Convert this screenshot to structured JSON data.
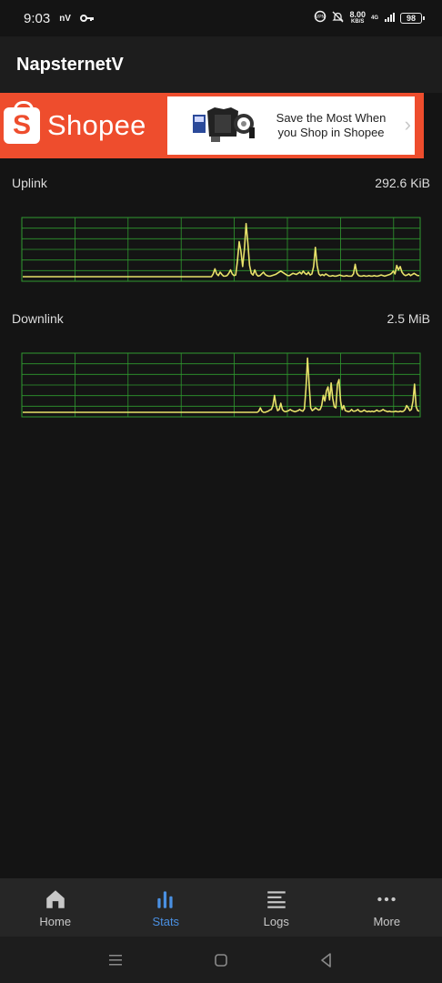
{
  "status_bar": {
    "time": "9:03",
    "carrier_text": "nV",
    "speed_value": "8.00",
    "speed_unit": "KB/S",
    "network_gen": "4G",
    "battery": "98",
    "icons": [
      "key-icon",
      "vpn-icon",
      "bell-muted-icon",
      "signal-icon",
      "battery-icon"
    ]
  },
  "app": {
    "title": "NapsternetV"
  },
  "ad": {
    "brand": "Shopee",
    "slogan": "Save the Most When you Shop in Shopee",
    "brand_color": "#ee4d2d"
  },
  "uplink": {
    "label": "Uplink",
    "value": "292.6 KiB",
    "samples": [
      0,
      0,
      0,
      0,
      0,
      0,
      0,
      0,
      0,
      0,
      0,
      0,
      0,
      0,
      0,
      0,
      0,
      0,
      0,
      0,
      0,
      0,
      0,
      0,
      0,
      0,
      0,
      0,
      0,
      0,
      0,
      0,
      0,
      0,
      0,
      0,
      0,
      0,
      0,
      0,
      0,
      0,
      0,
      0,
      0,
      0,
      0,
      0,
      0,
      0,
      0,
      0,
      0,
      0,
      0,
      0,
      0,
      0,
      0,
      0,
      0,
      0,
      0,
      0,
      0,
      0,
      0,
      0,
      0,
      0,
      0,
      0,
      0,
      0,
      0,
      0,
      0,
      0,
      0,
      0,
      0,
      0,
      0,
      0,
      0,
      0,
      0,
      0,
      0,
      0,
      0,
      0,
      0,
      0,
      0,
      0,
      0,
      0,
      0,
      0,
      0,
      0,
      0,
      0,
      0,
      0,
      0,
      0,
      0,
      0,
      0.05,
      0.14,
      0.05,
      0.02,
      0.08,
      0.04,
      0.01,
      0.01,
      0.02,
      0.06,
      0.12,
      0.05,
      0.02,
      0.03,
      0.28,
      0.62,
      0.45,
      0.18,
      0.48,
      0.94,
      0.6,
      0.2,
      0.06,
      0.03,
      0.12,
      0.04,
      0.01,
      0.02,
      0.05,
      0.08,
      0.04,
      0.02,
      0.01,
      0.01,
      0.02,
      0.03,
      0.04,
      0.06,
      0.08,
      0.1,
      0.08,
      0.06,
      0.04,
      0.02,
      0.02,
      0.04,
      0.06,
      0.05,
      0.04,
      0.06,
      0.08,
      0.05,
      0.1,
      0.06,
      0.04,
      0.08,
      0.03,
      0.05,
      0.18,
      0.52,
      0.2,
      0.05,
      0.02,
      0.04,
      0.02,
      0.05,
      0.03,
      0.01,
      0.01,
      0.02,
      0.01,
      0.01,
      0.02,
      0.03,
      0.02,
      0.01,
      0.01,
      0.02,
      0.01,
      0.01,
      0.01,
      0.05,
      0.22,
      0.06,
      0.02,
      0.01,
      0.01,
      0.02,
      0.01,
      0.01,
      0.02,
      0.01,
      0.01,
      0.02,
      0.01,
      0.01,
      0.02,
      0.03,
      0.02,
      0.01,
      0.02,
      0.03,
      0.04,
      0.06,
      0.1,
      0.05,
      0.2,
      0.12,
      0.18,
      0.08,
      0.04,
      0.02,
      0.03,
      0.05,
      0.02,
      0.04,
      0.06,
      0.04,
      0.02,
      0.02
    ]
  },
  "downlink": {
    "label": "Downlink",
    "value": "2.5 MiB",
    "samples": [
      0,
      0,
      0,
      0,
      0,
      0,
      0,
      0,
      0,
      0,
      0,
      0,
      0,
      0,
      0,
      0,
      0,
      0,
      0,
      0,
      0,
      0,
      0,
      0,
      0,
      0,
      0,
      0,
      0,
      0,
      0,
      0,
      0,
      0,
      0,
      0,
      0,
      0,
      0,
      0,
      0,
      0,
      0,
      0,
      0,
      0,
      0,
      0,
      0,
      0,
      0,
      0,
      0,
      0,
      0,
      0,
      0,
      0,
      0,
      0,
      0,
      0,
      0,
      0,
      0,
      0,
      0,
      0,
      0,
      0,
      0,
      0,
      0,
      0,
      0,
      0,
      0,
      0,
      0,
      0,
      0,
      0,
      0,
      0,
      0,
      0,
      0,
      0,
      0,
      0,
      0,
      0,
      0,
      0,
      0,
      0,
      0,
      0,
      0,
      0,
      0,
      0,
      0,
      0,
      0,
      0,
      0,
      0,
      0,
      0,
      0,
      0,
      0,
      0,
      0,
      0,
      0,
      0,
      0,
      0,
      0,
      0,
      0,
      0,
      0,
      0,
      0,
      0,
      0,
      0,
      0,
      0,
      0,
      0,
      0,
      0,
      0,
      0,
      0,
      0,
      0,
      0,
      0,
      0,
      0,
      0,
      0,
      0,
      0,
      0,
      0.02,
      0.08,
      0.02,
      0,
      0,
      0.01,
      0.02,
      0.04,
      0.05,
      0.12,
      0.3,
      0.12,
      0.03,
      0.05,
      0.16,
      0.05,
      0.02,
      0.01,
      0.02,
      0.03,
      0.05,
      0.03,
      0.02,
      0.01,
      0.02,
      0.03,
      0.05,
      0.03,
      0.02,
      0.06,
      0.42,
      0.96,
      0.5,
      0.08,
      0.03,
      0.05,
      0.08,
      0.06,
      0.04,
      0.05,
      0.12,
      0.3,
      0.2,
      0.38,
      0.45,
      0.22,
      0.52,
      0.25,
      0.1,
      0.08,
      0.5,
      0.58,
      0.2,
      0.05,
      0.12,
      0.03,
      0.02,
      0.01,
      0.02,
      0.05,
      0.02,
      0.02,
      0.03,
      0.05,
      0.02,
      0.01,
      0.02,
      0.04,
      0.02,
      0.01,
      0.02,
      0.01,
      0.02,
      0.01,
      0.02,
      0.04,
      0.02,
      0.02,
      0.03,
      0.05,
      0.03,
      0.02,
      0.01,
      0.02,
      0.01,
      0.01,
      0.01,
      0.02,
      0.01,
      0.01,
      0.02,
      0.01,
      0.02,
      0.05,
      0.12,
      0.08,
      0.03,
      0.05,
      0.2,
      0.5,
      0.1,
      0.03,
      0.02
    ]
  },
  "graph_colors": {
    "grid": "#2f9a2f",
    "line": "#e8e26a"
  },
  "nav": {
    "items": [
      {
        "label": "Home",
        "icon": "home-icon"
      },
      {
        "label": "Stats",
        "icon": "bar-chart-icon",
        "active": true
      },
      {
        "label": "Logs",
        "icon": "list-icon"
      },
      {
        "label": "More",
        "icon": "more-dots-icon"
      }
    ],
    "active_color": "#4a90e2"
  },
  "system_nav": {
    "icons": [
      "menu-icon",
      "home-square-icon",
      "back-icon"
    ]
  }
}
